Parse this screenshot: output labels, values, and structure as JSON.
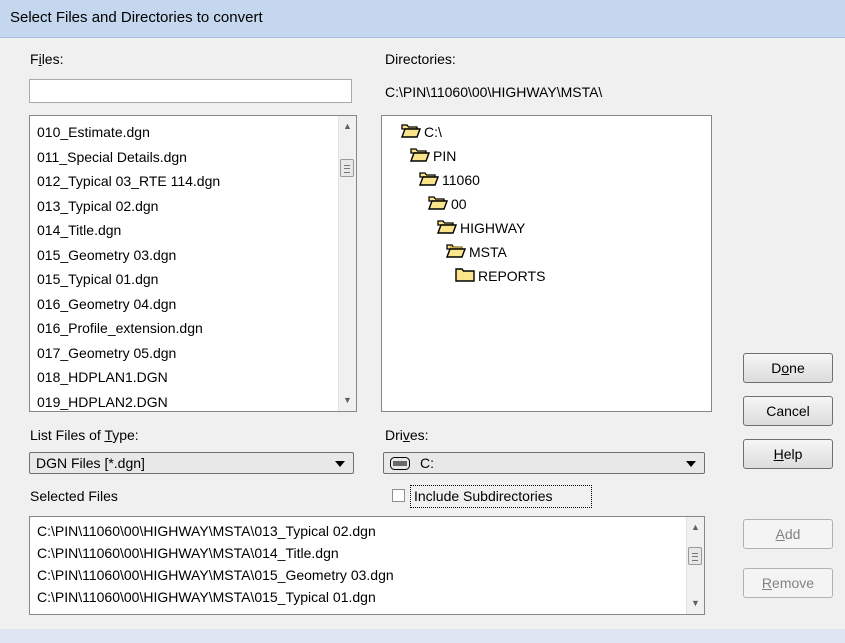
{
  "window": {
    "title": "Select Files and Directories to convert"
  },
  "files": {
    "label_pre": "F",
    "label_ul": "i",
    "label_post": "les:",
    "filter_value": "",
    "items": [
      "010_Estimate.dgn",
      "011_Special Details.dgn",
      "012_Typical 03_RTE 114.dgn",
      "013_Typical 02.dgn",
      "014_Title.dgn",
      "015_Geometry 03.dgn",
      "015_Typical 01.dgn",
      "016_Geometry 04.dgn",
      "016_Profile_extension.dgn",
      "017_Geometry 05.dgn",
      "018_HDPLAN1.DGN",
      "019_HDPLAN2.DGN"
    ]
  },
  "directories": {
    "label": "Directories:",
    "current_path": "C:\\PIN\\11060\\00\\HIGHWAY\\MSTA\\",
    "tree": [
      {
        "name": "C:\\",
        "state": "open"
      },
      {
        "name": "PIN",
        "state": "open"
      },
      {
        "name": "11060",
        "state": "open"
      },
      {
        "name": "00",
        "state": "open"
      },
      {
        "name": "HIGHWAY",
        "state": "open"
      },
      {
        "name": "MSTA",
        "state": "current"
      },
      {
        "name": "REPORTS",
        "state": "closed"
      }
    ]
  },
  "file_type": {
    "label_pre": "List Files of ",
    "label_ul": "T",
    "label_post": "ype:",
    "selected": "DGN Files [*.dgn]"
  },
  "drives": {
    "label_pre": "Dri",
    "label_ul": "v",
    "label_post": "es:",
    "selected": "C:"
  },
  "selected_files": {
    "label": "Selected Files",
    "items": [
      "C:\\PIN\\11060\\00\\HIGHWAY\\MSTA\\013_Typical 02.dgn",
      "C:\\PIN\\11060\\00\\HIGHWAY\\MSTA\\014_Title.dgn",
      "C:\\PIN\\11060\\00\\HIGHWAY\\MSTA\\015_Geometry 03.dgn",
      "C:\\PIN\\11060\\00\\HIGHWAY\\MSTA\\015_Typical 01.dgn"
    ]
  },
  "include_subdirectories": {
    "label": "Include Subdirectories",
    "checked": false
  },
  "buttons": {
    "done": {
      "pre": "D",
      "ul": "o",
      "post": "ne"
    },
    "cancel": {
      "pre": "",
      "ul": "",
      "post": "Cancel"
    },
    "help": {
      "pre": "",
      "ul": "H",
      "post": "elp"
    },
    "add": {
      "pre": "",
      "ul": "A",
      "post": "dd",
      "enabled": false
    },
    "remove": {
      "pre": "",
      "ul": "R",
      "post": "emove",
      "enabled": false
    }
  },
  "colors": {
    "titlebar": "#c4d7ee",
    "folder_fill": "#fbe58a",
    "folder_stroke": "#000000"
  },
  "icons": {
    "folder_open": "folder-open-icon",
    "folder_closed": "folder-icon",
    "drive": "hard-drive-icon"
  }
}
